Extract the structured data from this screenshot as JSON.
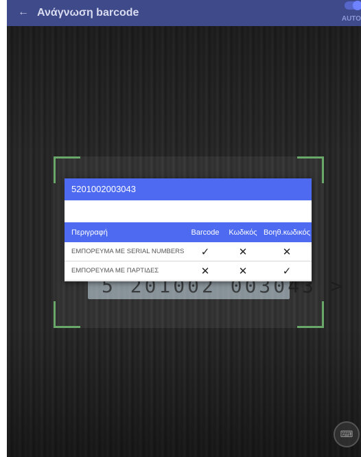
{
  "app_bar": {
    "title": "Ανάγνωση barcode",
    "back_icon": "arrow-left-icon",
    "auto_label": "AUTO"
  },
  "scan": {
    "barcode_text": "5 201002 003043 >"
  },
  "dialog": {
    "code": "5201002003043",
    "columns": [
      "Περιγραφή",
      "Barcode",
      "Κωδικός",
      "Βοηθ.κωδικός"
    ],
    "rows": [
      {
        "description": "ΕΜΠΟΡΕΥΜΑ ΜΕ SERIAL NUMBERS",
        "barcode": "✓",
        "code": "✕",
        "aux_code": "✕"
      },
      {
        "description": "ΕΜΠΟΡΕΥΜΑ ΜΕ ΠΑΡΤΙΔΕΣ",
        "barcode": "✕",
        "code": "✕",
        "aux_code": "✓"
      }
    ]
  },
  "fab": {
    "icon": "keyboard-icon",
    "glyph": "⌨"
  },
  "colors": {
    "app_bar": "#3f4a8a",
    "dialog_header": "#4d6af0",
    "scan_corners": "#6aa86a"
  }
}
